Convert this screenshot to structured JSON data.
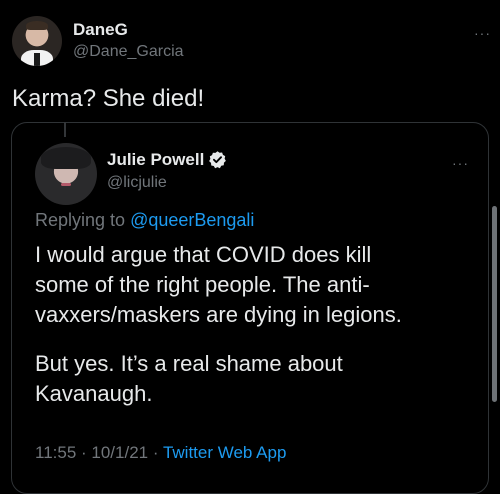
{
  "outer_tweet": {
    "author_name": "DaneG",
    "author_handle": "@Dane_Garcia",
    "text": "Karma? She died!",
    "more_label": "···"
  },
  "quoted_tweet": {
    "author_name": "Julie Powell",
    "author_handle": "@licjulie",
    "more_label": "···",
    "replying_to_prefix": "Replying to ",
    "replying_to_handle": "@queerBengali",
    "paragraph1_lines": [
      "I would argue that COVID does kill",
      "some of the right people. The anti-",
      "vaxxers/maskers are dying in legions."
    ],
    "paragraph2_lines": [
      "But yes. It’s a real shame about",
      "Kavanaugh."
    ],
    "time": "11:55",
    "separator": " · ",
    "date": "10/1/21",
    "source": "Twitter Web App"
  },
  "colors": {
    "background": "#000000",
    "text_primary": "#e7e9ea",
    "text_secondary": "#71767b",
    "link": "#1d9bf0",
    "border": "#2f3336"
  },
  "icons": {
    "verified": "verified-badge-icon",
    "more": "more-horizontal-icon"
  }
}
